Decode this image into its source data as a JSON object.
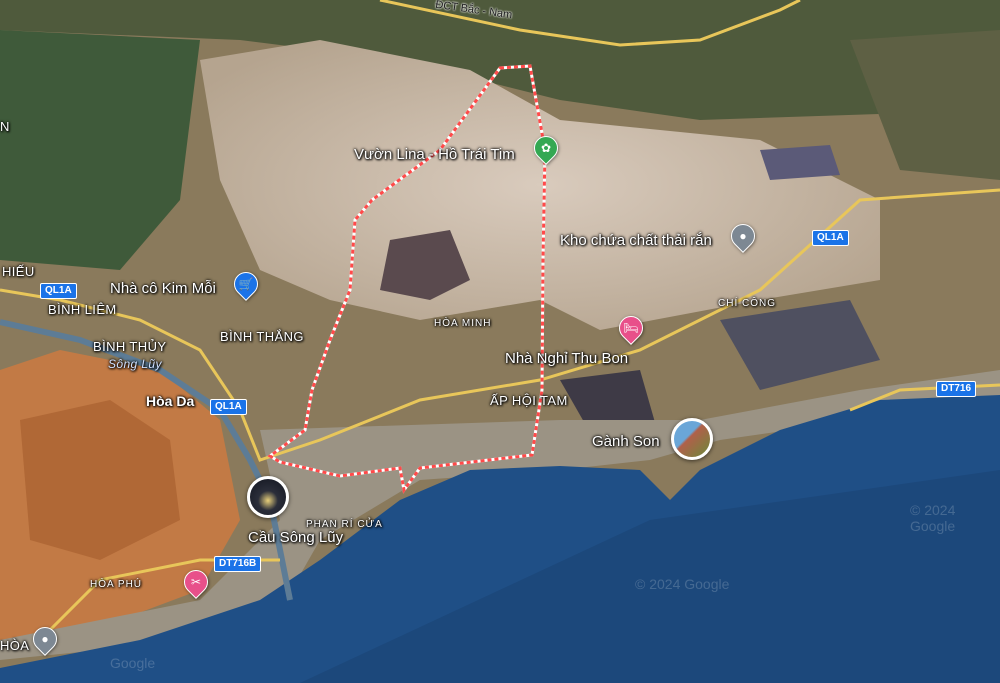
{
  "map": {
    "poi": {
      "vuon_lina": "Vườn Lina - Hồ Trái Tim",
      "kho_chua": "Kho chứa chất thải rắn",
      "nha_co_kim_moi": "Nhà cô Kim Mỗi",
      "nha_nghi": "Nhà Nghỉ Thu Bon",
      "ganh_son": "Gành Son",
      "cau_song_luy": "Cầu Sông Lũy"
    },
    "places": {
      "dct": "ĐCT Bắc - Nam",
      "hieu": "HIẾU",
      "binh_liem": "BÌNH LIÊM",
      "binh_thang": "BÌNH THẮNG",
      "binh_thuy": "BÌNH THỦY",
      "song_luy": "Sông Lũy",
      "hoa_da": "Hòa Da",
      "hoa_minh": "HÒA MINH",
      "chi_cong": "CHÍ CÔNG",
      "ap_hoi_tam": "ẤP HỘI TAM",
      "phan_ri_cua": "PHAN RÍ CỬA",
      "hoa_phu": "HÒA PHÚ",
      "hoa": "HÒA",
      "n_letter": "N"
    },
    "shields": {
      "ql1a_left": "QL1A",
      "ql1a_mid": "QL1A",
      "ql1a_right": "QL1A",
      "dt716": "DT716",
      "dt716b": "DT716B"
    },
    "watermark": {
      "mid": "© 2024 Google",
      "right": "© 2024 Google",
      "bottom": "Google"
    },
    "colors": {
      "sea": "#1f4f86",
      "boundary": "#ff4a4a",
      "pin_blue": "#1a73e8",
      "pin_green": "#34a853",
      "pin_pink": "#e8508a",
      "pin_gray": "#7d8893"
    }
  }
}
